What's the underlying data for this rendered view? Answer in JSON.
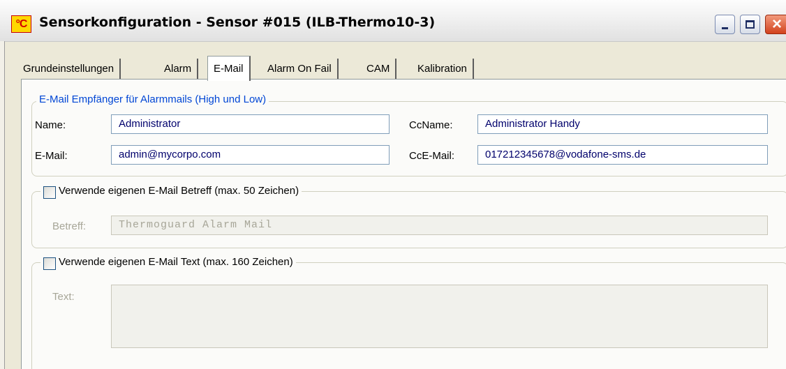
{
  "window": {
    "icon_text": "°C",
    "title": "Sensorkonfiguration - Sensor #015 (ILB-Thermo10-3)",
    "close_glyph": "×"
  },
  "tabs": [
    {
      "label": "Grundeinstellungen",
      "active": false
    },
    {
      "label": "Alarm",
      "active": false
    },
    {
      "label": "E-Mail",
      "active": true
    },
    {
      "label": "Alarm On Fail",
      "active": false
    },
    {
      "label": "CAM",
      "active": false
    },
    {
      "label": "Kalibration",
      "active": false
    }
  ],
  "recipients": {
    "legend": "E-Mail Empfänger für Alarmmails (High und Low)",
    "name_label": "Name:",
    "name_value": "Administrator",
    "email_label": "E-Mail:",
    "email_value": "admin@mycorpo.com",
    "ccname_label": "CcName:",
    "ccname_value": "Administrator Handy",
    "ccemail_label": "CcE-Mail:",
    "ccemail_value": "017212345678@vodafone-sms.de"
  },
  "subject": {
    "checkbox_label": "Verwende eigenen E-Mail Betreff (max. 50 Zeichen)",
    "checked": false,
    "field_label": "Betreff:",
    "field_value": "Thermoguard Alarm Mail"
  },
  "body_text": {
    "checkbox_label": "Verwende eigenen E-Mail Text (max. 160 Zeichen)",
    "checked": false,
    "field_label": "Text:",
    "field_value": ""
  },
  "colors": {
    "accent_legend": "#0046d5",
    "field_text": "#00006c",
    "disabled_text": "#a7a698",
    "close_button": "#d2421d"
  }
}
